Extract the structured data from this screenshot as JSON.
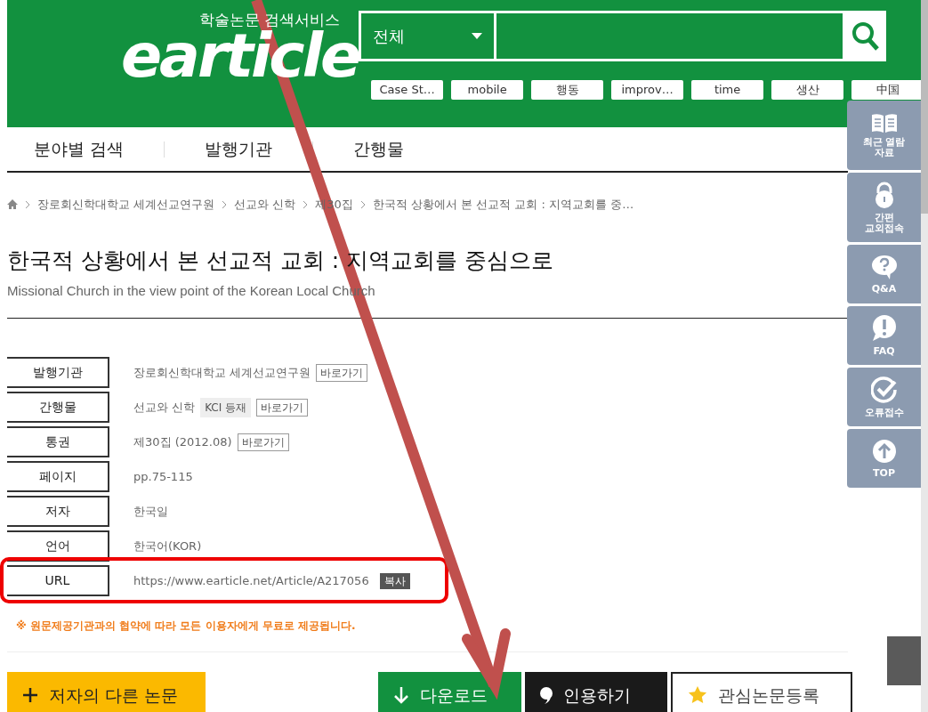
{
  "header": {
    "logo_main": "earticle",
    "logo_sub": "학술논문 검색서비스",
    "search": {
      "scope": "전체"
    },
    "keywords": [
      "Case St…",
      "mobile",
      "행동",
      "improv…",
      "time",
      "생산",
      "中国"
    ]
  },
  "nav": [
    "분야별 검색",
    "발행기관",
    "간행물"
  ],
  "breadcrumb": [
    "장로회신학대학교 세계선교연구원",
    "선교와 신학",
    "제30집",
    "한국적 상황에서 본 선교적 교회 : 지역교회를 중…"
  ],
  "title": "한국적 상황에서 본 선교적 교회 : 지역교회를 중심으로",
  "subtitle": "Missional Church in the view point of the Korean Local Church",
  "details": [
    {
      "label": "발행기관",
      "value": "장로회신학대학교 세계선교연구원",
      "link": "바로가기",
      "highlighted": false
    },
    {
      "label": "간행물",
      "value": "선교와 신학",
      "badge": "KCI 등재",
      "link": "바로가기",
      "highlighted": false
    },
    {
      "label": "통권",
      "value": "제30집 (2012.08)",
      "link": "바로가기",
      "highlighted": false
    },
    {
      "label": "페이지",
      "value": "pp.75-115",
      "highlighted": false
    },
    {
      "label": "저자",
      "value": "한국일",
      "highlighted": false
    },
    {
      "label": "언어",
      "value": "한국어(KOR)",
      "highlighted": false
    },
    {
      "label": "URL",
      "value": "https://www.earticle.net/Article/A217056",
      "copy": "복사",
      "highlighted": true
    }
  ],
  "notice": "※ 원문제공기관과의 협약에 따라 모든 이용자에게 무료로 제공됩니다.",
  "actions": [
    {
      "label": "저자의 다른 논문",
      "kind": "author"
    },
    {
      "label": "다운로드",
      "kind": "download"
    },
    {
      "label": "인용하기",
      "kind": "cite"
    },
    {
      "label": "관심논문등록",
      "kind": "favorite"
    }
  ],
  "quick_menu": [
    {
      "label": "최근 열람\n자료",
      "kind": "book"
    },
    {
      "label": "간편\n교외접속",
      "kind": "lock"
    },
    {
      "label": "Q&A",
      "kind": "question"
    },
    {
      "label": "FAQ",
      "kind": "exclaim"
    },
    {
      "label": "오류접수",
      "kind": "check"
    },
    {
      "label": "TOP",
      "kind": "top"
    }
  ]
}
